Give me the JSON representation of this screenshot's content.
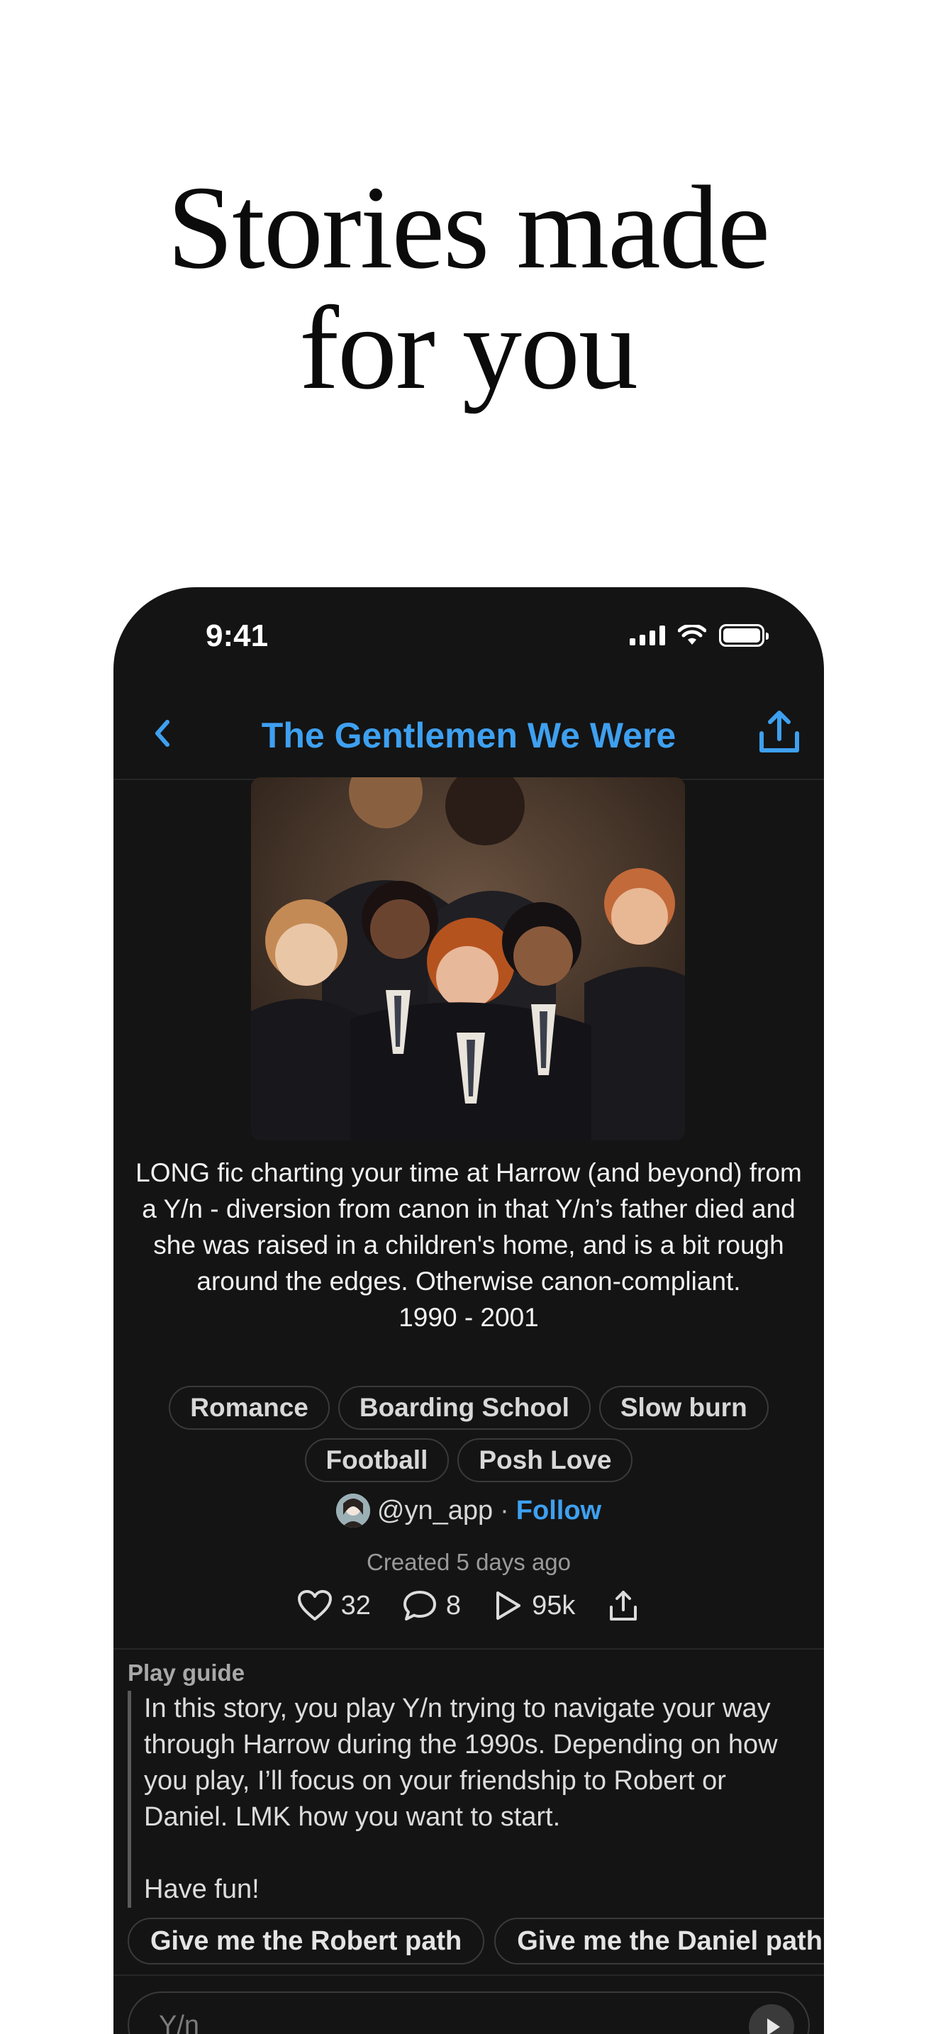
{
  "hero": {
    "line1": "Stories made",
    "line2": "for you"
  },
  "status_bar": {
    "time": "9:41"
  },
  "nav": {
    "title": "The Gentlemen We Were"
  },
  "story": {
    "description": "LONG fic charting your time at Harrow (and beyond) from a Y/n - diversion from canon in that Y/n’s father died and she was raised in a children's home, and is a bit rough around the edges. Otherwise canon-compliant.",
    "years": "1990 - 2001",
    "tags_row1": [
      "Romance",
      "Boarding School",
      "Slow burn"
    ],
    "tags_row2": [
      "Football",
      "Posh Love"
    ],
    "author_handle": "@yn_app",
    "separator": "·",
    "follow_label": "Follow",
    "created": "Created 5 days ago"
  },
  "stats": {
    "likes": "32",
    "comments": "8",
    "plays": "95k"
  },
  "play_guide": {
    "label": "Play guide",
    "paragraph1": "In this story, you play Y/n trying to navigate your way through Harrow during the 1990s. Depending on how you play, I’ll focus on your friendship to Robert or Daniel. LMK how you want to start.",
    "paragraph2": "Have fun!"
  },
  "suggestions": [
    "Give me the Robert path",
    "Give me the Daniel path"
  ],
  "composer": {
    "placeholder": "Y/n"
  },
  "colors": {
    "accent": "#3ea0f0",
    "background": "#141414",
    "page": "#ffffff"
  }
}
